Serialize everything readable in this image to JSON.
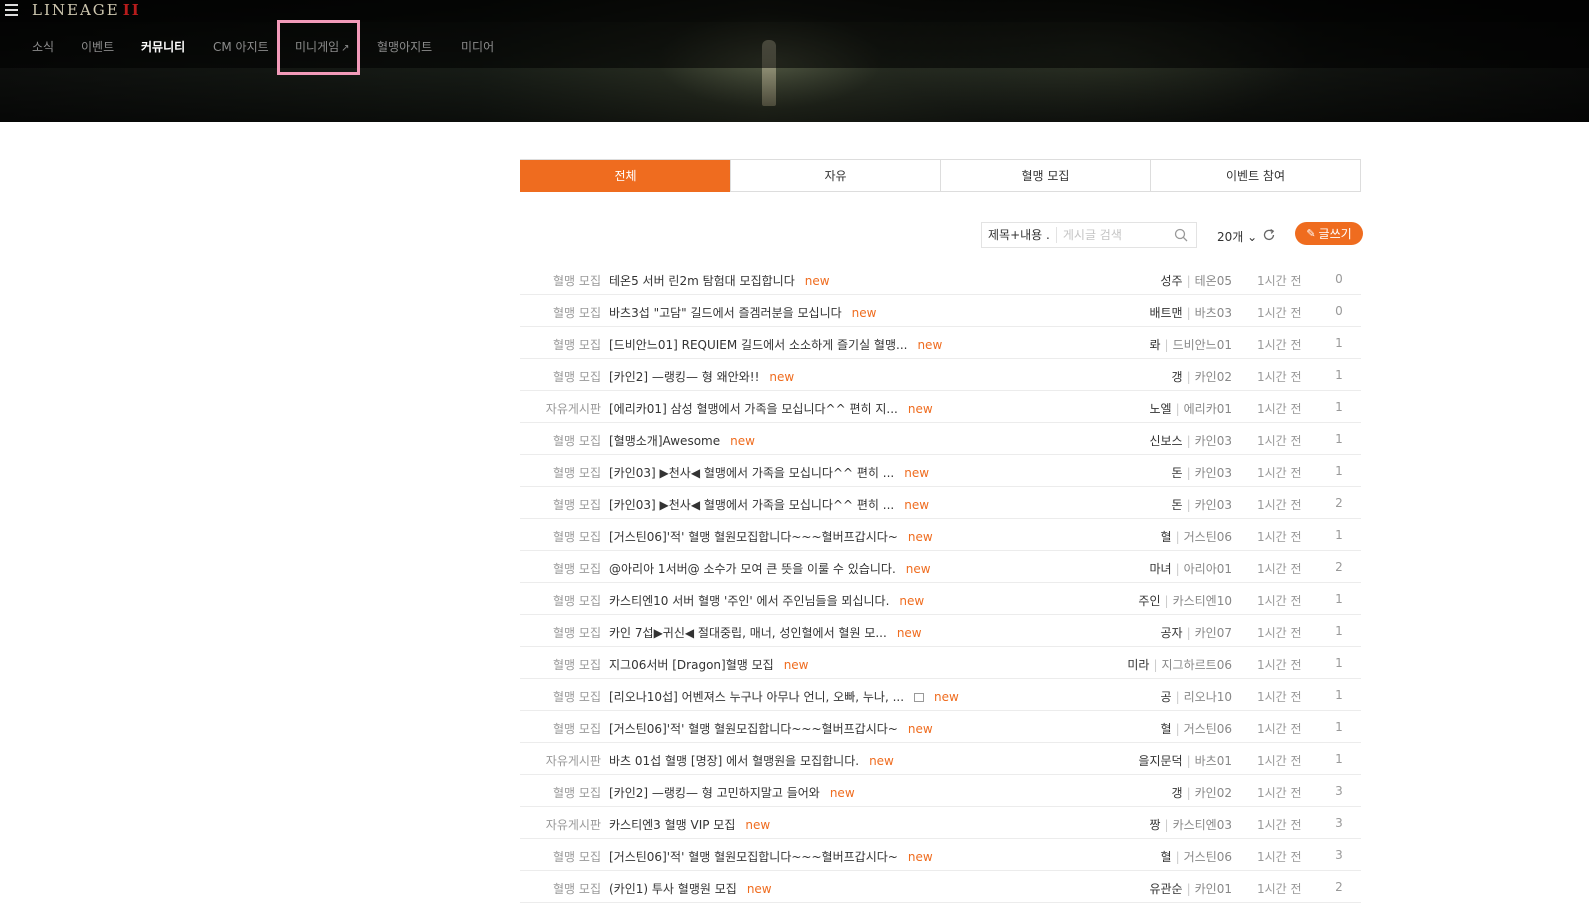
{
  "header": {
    "logo_text": "LINEAGE",
    "logo_numeral": "II",
    "nav": [
      {
        "label": "소식",
        "active": false,
        "external": false
      },
      {
        "label": "이벤트",
        "active": false,
        "external": false
      },
      {
        "label": "커뮤니티",
        "active": true,
        "external": false
      },
      {
        "label": "CM 아지트",
        "active": false,
        "external": false
      },
      {
        "label": "미니게임",
        "active": false,
        "external": true
      },
      {
        "label": "혈맹아지트",
        "active": false,
        "external": false
      },
      {
        "label": "미디어",
        "active": false,
        "external": false
      }
    ],
    "external_glyph": "↗",
    "highlight_color": "#f29ab9"
  },
  "tabs": [
    {
      "label": "전체",
      "active": true
    },
    {
      "label": "자유",
      "active": false
    },
    {
      "label": "혈맹 모집",
      "active": false
    },
    {
      "label": "이벤트 참여",
      "active": false
    }
  ],
  "toolbar": {
    "search_scope": "제목+내용 .",
    "search_placeholder": "게시글 검색",
    "count_label": "20개",
    "count_chevron": "⌄",
    "write_label": "글쓰기",
    "accent_color": "#ef6c1f"
  },
  "posts": [
    {
      "category": "혈맹 모집",
      "title": "테온5 서버 린2m 탐험대 모집합니다",
      "badge": "new",
      "author": "성주",
      "server": "테온05",
      "time": "1시간 전",
      "comments": "0"
    },
    {
      "category": "혈맹 모집",
      "title": "바츠3섭 \"고담\" 길드에서 즐겜러분을 모십니다",
      "badge": "new",
      "author": "배트맨",
      "server": "바츠03",
      "time": "1시간 전",
      "comments": "0"
    },
    {
      "category": "혈맹 모집",
      "title": "[드비안느01] REQUIEM 길드에서 소소하게 즐기실 혈맹...",
      "badge": "new",
      "author": "롸",
      "server": "드비안느01",
      "time": "1시간 전",
      "comments": "1"
    },
    {
      "category": "혈맹 모집",
      "title": "[카인2] —랭킹— 형 왜안와!!",
      "badge": "new",
      "author": "갱",
      "server": "카인02",
      "time": "1시간 전",
      "comments": "1"
    },
    {
      "category": "자유게시판",
      "title": "[에리카01] 삼성 혈맹에서 가족을 모십니다^^ 편히 지...",
      "badge": "new",
      "author": "노엘",
      "server": "에리카01",
      "time": "1시간 전",
      "comments": "1"
    },
    {
      "category": "혈맹 모집",
      "title": "[혈맹소개]Awesome",
      "badge": "new",
      "author": "신보스",
      "server": "카인03",
      "time": "1시간 전",
      "comments": "1"
    },
    {
      "category": "혈맹 모집",
      "title": "[카인03] ▶천사◀ 혈맹에서 가족을 모십니다^^ 편히 ...",
      "badge": "new",
      "author": "돈",
      "server": "카인03",
      "time": "1시간 전",
      "comments": "1"
    },
    {
      "category": "혈맹 모집",
      "title": "[카인03] ▶천사◀ 혈맹에서 가족을 모십니다^^ 편히 ...",
      "badge": "new",
      "author": "돈",
      "server": "카인03",
      "time": "1시간 전",
      "comments": "2"
    },
    {
      "category": "혈맹 모집",
      "title": "[거스틴06]'적' 혈맹 혈원모집합니다~~~혈버프갑시다~",
      "badge": "new",
      "author": "혈",
      "server": "거스틴06",
      "time": "1시간 전",
      "comments": "1"
    },
    {
      "category": "혈맹 모집",
      "title": "@아리아 1서버@ 소수가 모여 큰 뜻을 이룰 수 있습니다.",
      "badge": "new",
      "author": "마녀",
      "server": "아리아01",
      "time": "1시간 전",
      "comments": "2"
    },
    {
      "category": "혈맹 모집",
      "title": "카스티엔10 서버 혈맹 '주인' 에서 주인님들을 뫼십니다.",
      "badge": "new",
      "author": "주인",
      "server": "카스티엔10",
      "time": "1시간 전",
      "comments": "1"
    },
    {
      "category": "혈맹 모집",
      "title": "카인 7섭▶귀신◀ 절대중립, 매너, 성인혈에서 혈원 모...",
      "badge": "new",
      "author": "공자",
      "server": "카인07",
      "time": "1시간 전",
      "comments": "1"
    },
    {
      "category": "혈맹 모집",
      "title": "지그06서버 [Dragon]혈맹 모집",
      "badge": "new",
      "author": "미라",
      "server": "지그하르트06",
      "time": "1시간 전",
      "comments": "1"
    },
    {
      "category": "혈맹 모집",
      "title": "[리오나10섭] 어벤져스 누구나 아무나 언니, 오빠, 누나, ...",
      "badge": "new",
      "has_image": true,
      "author": "공",
      "server": "리오나10",
      "time": "1시간 전",
      "comments": "1"
    },
    {
      "category": "혈맹 모집",
      "title": "[거스틴06]'적' 혈맹 혈원모집합니다~~~혈버프갑시다~",
      "badge": "new",
      "author": "혈",
      "server": "거스틴06",
      "time": "1시간 전",
      "comments": "1"
    },
    {
      "category": "자유게시판",
      "title": "바츠 01섭 혈맹 [명장] 에서 혈맹원을 모집합니다.",
      "badge": "new",
      "author": "을지문덕",
      "server": "바츠01",
      "time": "1시간 전",
      "comments": "1"
    },
    {
      "category": "혈맹 모집",
      "title": "[카인2] —랭킹— 형 고민하지말고 들어와",
      "badge": "new",
      "author": "갱",
      "server": "카인02",
      "time": "1시간 전",
      "comments": "3"
    },
    {
      "category": "자유게시판",
      "title": "카스티엔3 혈맹 VIP 모집",
      "badge": "new",
      "author": "짱",
      "server": "카스티엔03",
      "time": "1시간 전",
      "comments": "3"
    },
    {
      "category": "혈맹 모집",
      "title": "[거스틴06]'적' 혈맹 혈원모집합니다~~~혈버프갑시다~",
      "badge": "new",
      "author": "혈",
      "server": "거스틴06",
      "time": "1시간 전",
      "comments": "3"
    },
    {
      "category": "혈맹 모집",
      "title": "(카인1) 투사 혈맹원 모집",
      "badge": "new",
      "author": "유관순",
      "server": "카인01",
      "time": "1시간 전",
      "comments": "2"
    }
  ]
}
